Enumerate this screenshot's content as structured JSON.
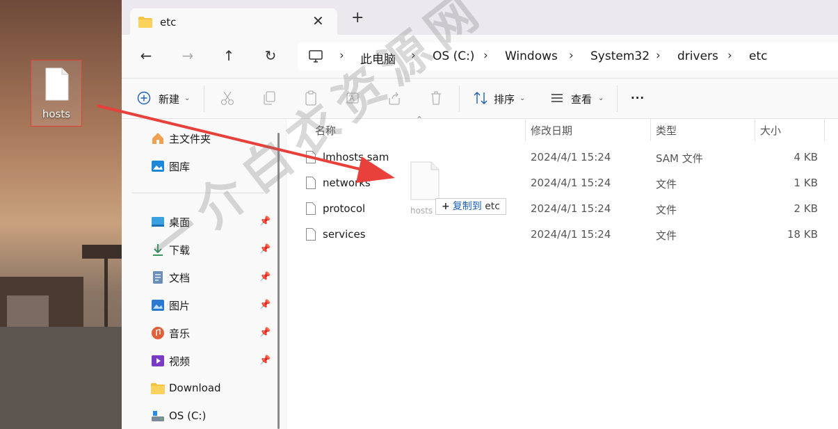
{
  "desktop": {
    "icon_label": "hosts"
  },
  "tab": {
    "title": "etc",
    "close": "✕",
    "new": "+"
  },
  "nav": {
    "back": "←",
    "forward": "→",
    "up": "↑",
    "refresh": "↻"
  },
  "breadcrumb": [
    "此电脑",
    "OS (C:)",
    "Windows",
    "System32",
    "drivers",
    "etc"
  ],
  "toolbar": {
    "new_label": "新建",
    "sort_label": "排序",
    "view_label": "查看",
    "more": "···"
  },
  "sidebar": {
    "top": [
      {
        "label": "主文件夹",
        "icon": "home-icon"
      },
      {
        "label": "图库",
        "icon": "gallery-icon"
      }
    ],
    "quick": [
      {
        "label": "桌面",
        "icon": "desktop-icon",
        "pinned": true
      },
      {
        "label": "下载",
        "icon": "download-icon",
        "pinned": true
      },
      {
        "label": "文档",
        "icon": "document-icon",
        "pinned": true
      },
      {
        "label": "图片",
        "icon": "pictures-icon",
        "pinned": true
      },
      {
        "label": "音乐",
        "icon": "music-icon",
        "pinned": true
      },
      {
        "label": "视频",
        "icon": "video-icon",
        "pinned": true
      },
      {
        "label": "Download",
        "icon": "folder-icon",
        "pinned": false
      },
      {
        "label": "OS (C:)",
        "icon": "drive-icon",
        "pinned": false
      }
    ]
  },
  "columns": {
    "name": "名称",
    "modified": "修改日期",
    "type": "类型",
    "size": "大小"
  },
  "files": [
    {
      "name": "lmhosts.sam",
      "modified": "2024/4/1 15:24",
      "type": "SAM 文件",
      "size": "4 KB"
    },
    {
      "name": "networks",
      "modified": "2024/4/1 15:24",
      "type": "文件",
      "size": "1 KB"
    },
    {
      "name": "protocol",
      "modified": "2024/4/1 15:24",
      "type": "文件",
      "size": "2 KB"
    },
    {
      "name": "services",
      "modified": "2024/4/1 15:24",
      "type": "文件",
      "size": "18 KB"
    }
  ],
  "drag": {
    "ghost_label": "hosts",
    "tooltip_action": "复制到",
    "tooltip_target": "etc"
  },
  "watermark": "一介白衣资源网",
  "colors": {
    "arrow": "#e8403a",
    "accent": "#1a5fb4"
  }
}
